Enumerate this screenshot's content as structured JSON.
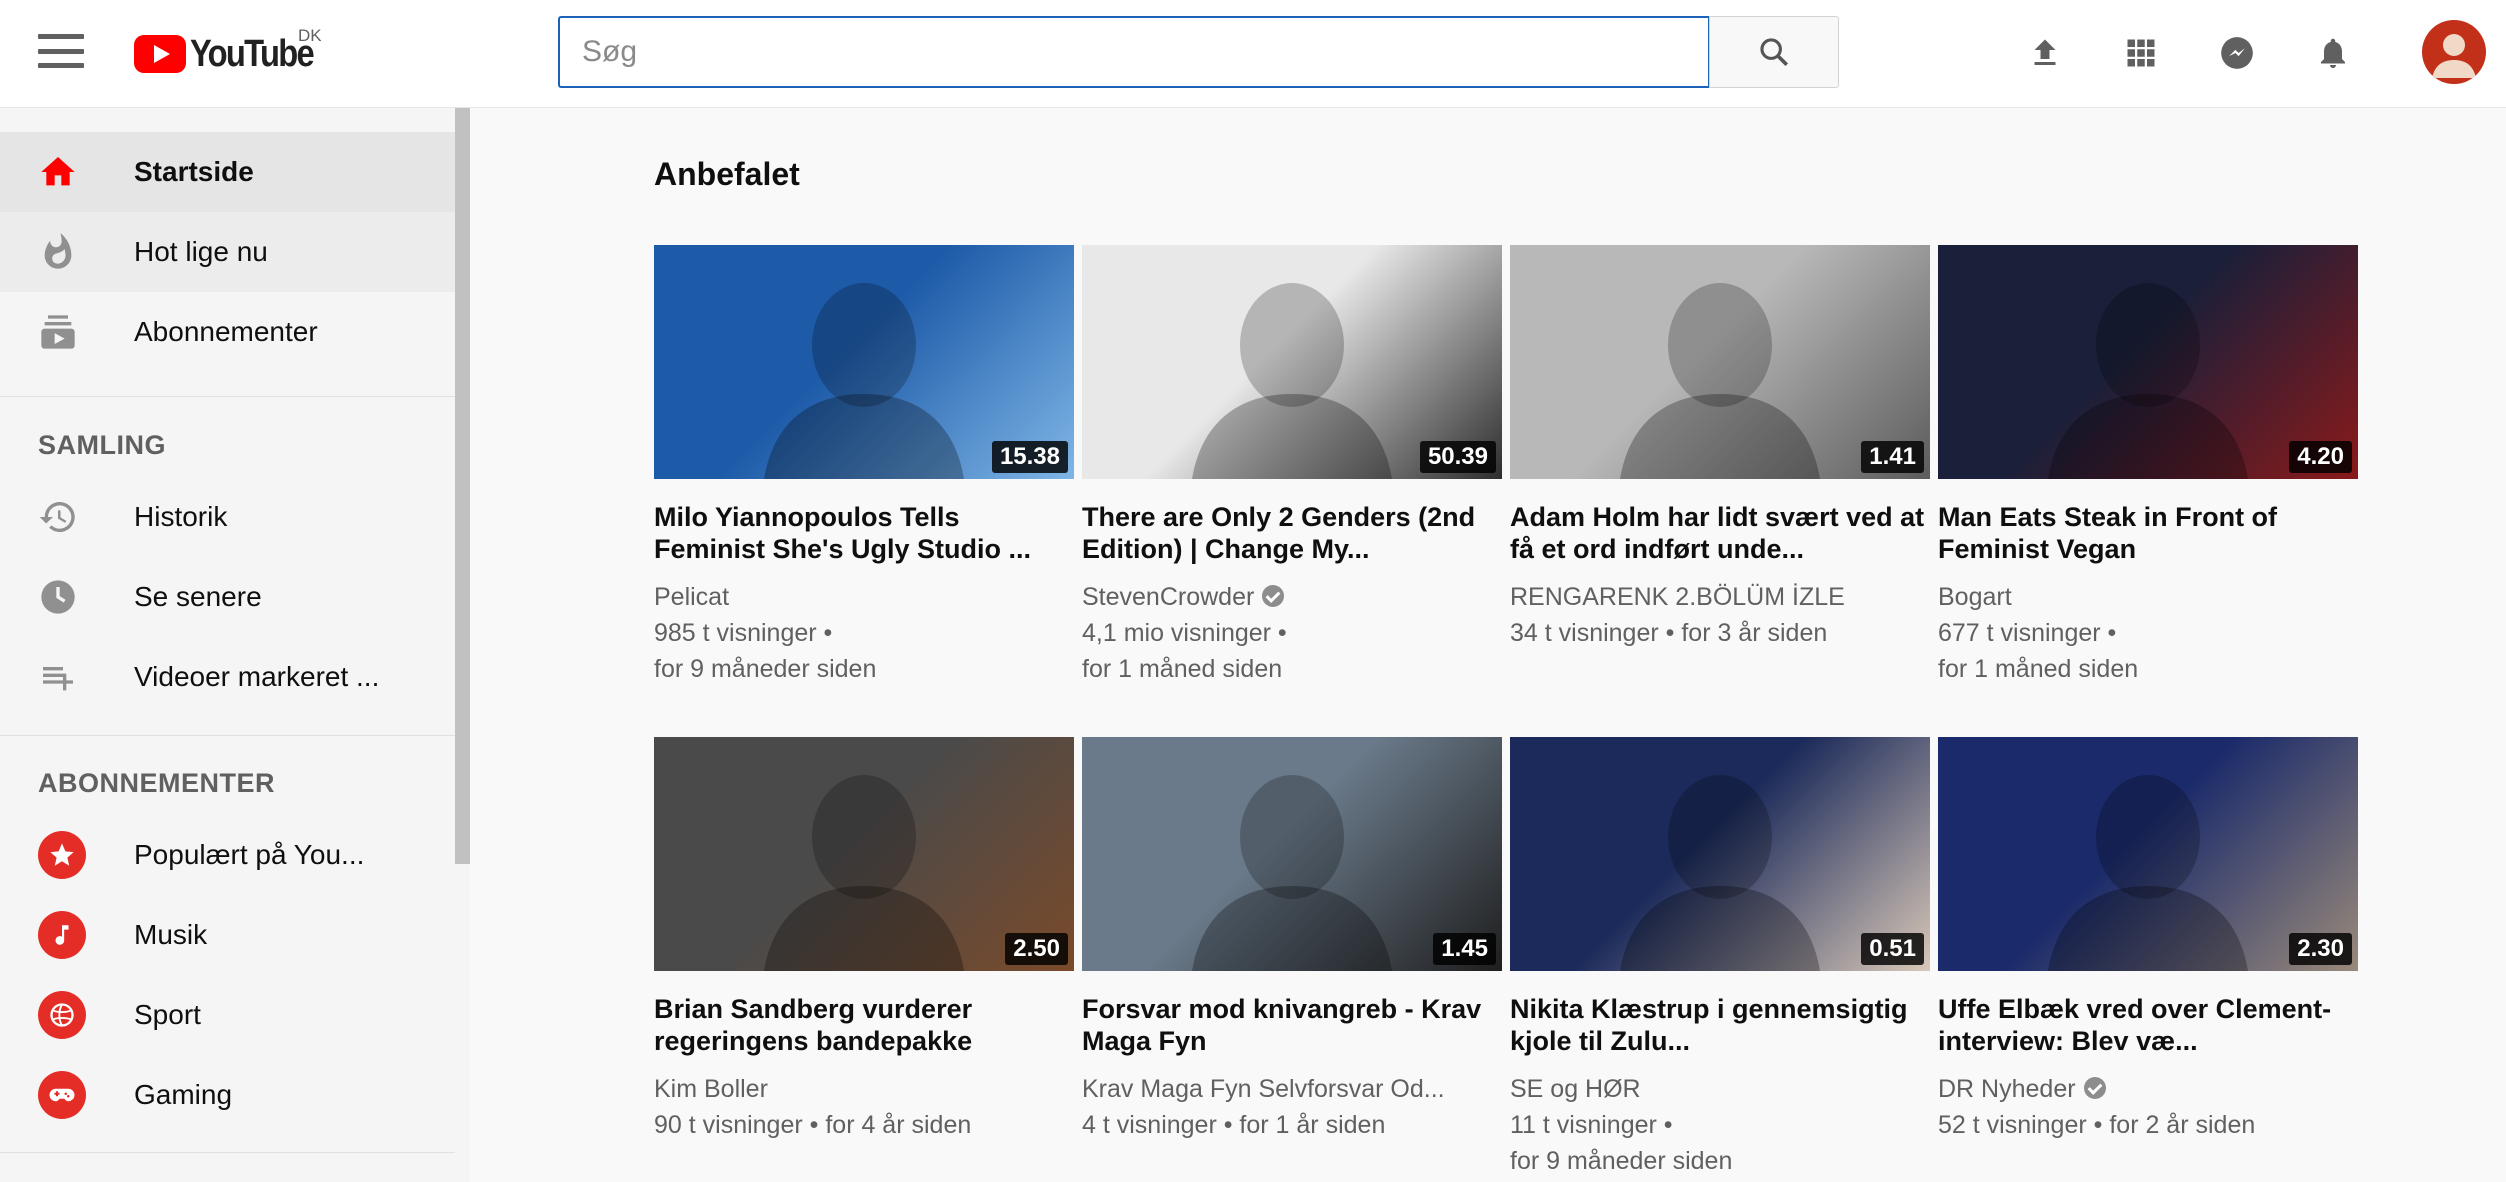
{
  "header": {
    "logo_text": "YouTube",
    "country": "DK",
    "search_placeholder": "Søg",
    "icons": [
      "upload-icon",
      "apps-icon",
      "messages-icon",
      "notifications-icon"
    ]
  },
  "sidebar": {
    "main": [
      {
        "label": "Startside",
        "icon": "home-icon"
      },
      {
        "label": "Hot lige nu",
        "icon": "trending-icon"
      },
      {
        "label": "Abonnementer",
        "icon": "subscriptions-icon"
      }
    ],
    "library_title": "SAMLING",
    "library": [
      {
        "label": "Historik",
        "icon": "history-icon"
      },
      {
        "label": "Se senere",
        "icon": "clock-icon"
      },
      {
        "label": "Videoer markeret ...",
        "icon": "playlist-icon"
      }
    ],
    "subs_title": "ABONNEMENTER",
    "subs": [
      {
        "label": "Populært på You...",
        "icon": "star-icon"
      },
      {
        "label": "Musik",
        "icon": "music-icon"
      },
      {
        "label": "Sport",
        "icon": "sport-icon"
      },
      {
        "label": "Gaming",
        "icon": "gamepad-icon"
      }
    ]
  },
  "main": {
    "section_title": "Anbefalet",
    "videos": [
      {
        "title": "Milo Yiannopoulos Tells Feminist She's Ugly Studio ...",
        "channel": "Pelicat",
        "verified": false,
        "views": "985 t visninger •",
        "age": "for 9 måneder siden",
        "duration": "15.38",
        "thumb_colors": [
          "#1d5aa8",
          "#7fb6e6"
        ]
      },
      {
        "title": "There are Only 2 Genders (2nd Edition) | Change My...",
        "channel": "StevenCrowder",
        "verified": true,
        "views": "4,1 mio visninger •",
        "age": "for 1 måned siden",
        "duration": "50.39",
        "thumb_colors": [
          "#e8e8e8",
          "#2d2d2d"
        ]
      },
      {
        "title": "Adam Holm har lidt svært ved at få et ord indført unde...",
        "channel": "RENGARENK 2.BÖLÜM İZLE",
        "verified": false,
        "views": "34 t visninger • for 3 år siden",
        "age": "",
        "duration": "1.41",
        "thumb_colors": [
          "#b8b8b8",
          "#5c5c5c"
        ]
      },
      {
        "title": "Man Eats Steak in Front of Feminist Vegan",
        "channel": "Bogart",
        "verified": false,
        "views": "677 t visninger •",
        "age": "for 1 måned siden",
        "duration": "4.20",
        "thumb_colors": [
          "#1a1f3a",
          "#8a1a1a"
        ]
      },
      {
        "title": "Brian Sandberg vurderer regeringens bandepakke",
        "channel": "Kim Boller",
        "verified": false,
        "views": "90 t visninger • for 4 år siden",
        "age": "",
        "duration": "2.50",
        "thumb_colors": [
          "#4a4a4a",
          "#7a4a2a"
        ]
      },
      {
        "title": "Forsvar mod knivangreb - Krav Maga Fyn",
        "channel": "Krav Maga Fyn Selvforsvar Od...",
        "verified": false,
        "views": "4 t visninger • for 1 år siden",
        "age": "",
        "duration": "1.45",
        "thumb_colors": [
          "#6a7a8a",
          "#1e1e1e"
        ]
      },
      {
        "title": "Nikita Klæstrup i gennemsigtig kjole til Zulu...",
        "channel": "SE og HØR",
        "verified": false,
        "views": "11 t visninger •",
        "age": "for 9 måneder siden",
        "duration": "0.51",
        "thumb_colors": [
          "#1b2a5a",
          "#d9c8b8"
        ]
      },
      {
        "title": "Uffe Elbæk vred over Clement-interview: Blev væ...",
        "channel": "DR Nyheder",
        "verified": true,
        "views": "52 t visninger • for 2 år siden",
        "age": "",
        "duration": "2.30",
        "thumb_colors": [
          "#1a2a6a",
          "#9a8a7a"
        ]
      }
    ]
  }
}
